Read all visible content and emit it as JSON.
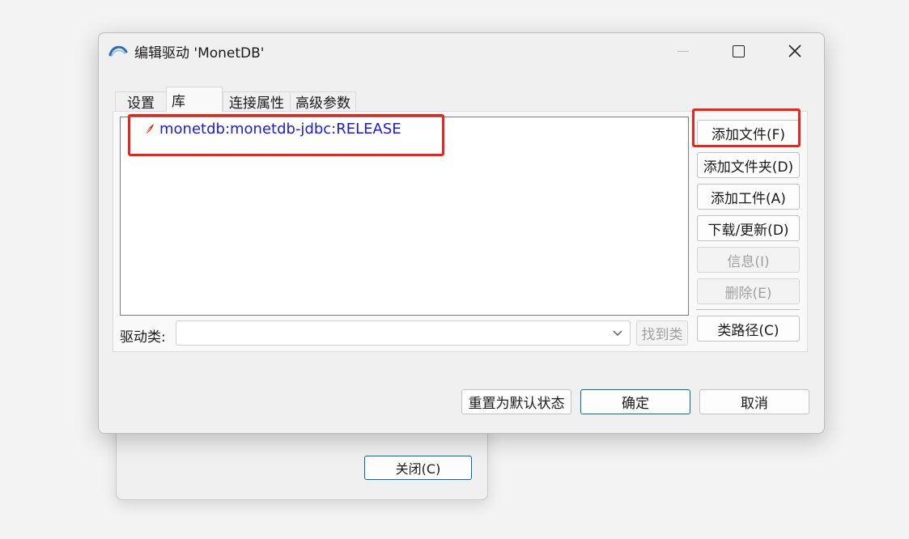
{
  "background_dialog": {
    "close_label": "关闭(C)"
  },
  "window": {
    "title": "编辑驱动 'MonetDB'"
  },
  "tabs": [
    {
      "label": "设置",
      "active": false
    },
    {
      "label": "库",
      "active": true
    },
    {
      "label": "连接属性",
      "active": false
    },
    {
      "label": "高级参数",
      "active": false
    }
  ],
  "libraries": [
    {
      "label": "monetdb:monetdb-jdbc:RELEASE",
      "icon": "maven-feather-icon"
    }
  ],
  "side_buttons": {
    "add_file": "添加文件(F)",
    "add_folder": "添加文件夹(D)",
    "add_artifact": "添加工件(A)",
    "download_update": "下载/更新(D)",
    "info": "信息(I)",
    "delete": "删除(E)",
    "classpath": "类路径(C)"
  },
  "driver_class": {
    "label": "驱动类:",
    "value": "",
    "find_label": "找到类"
  },
  "footer": {
    "reset_label": "重置为默认状态",
    "ok_label": "确定",
    "cancel_label": "取消"
  },
  "colors": {
    "highlight_red": "#e8251e",
    "accent": "#0067c0",
    "link_blue": "#1b1bd6"
  }
}
